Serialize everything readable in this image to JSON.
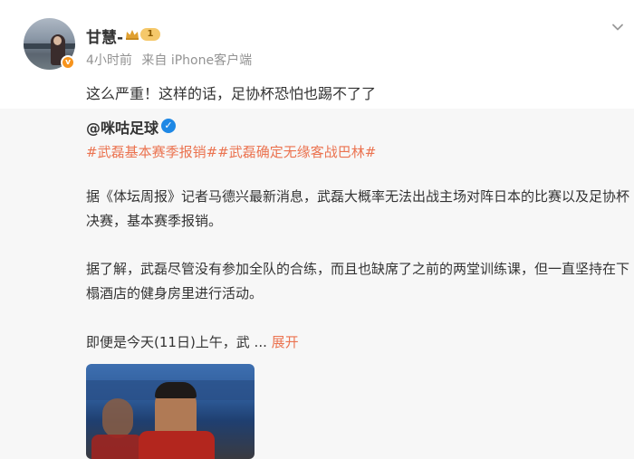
{
  "post": {
    "author_name": "甘慧-",
    "level": "1",
    "time": "4小时前",
    "source": "来自 iPhone客户端",
    "text": "这么严重！这样的话，足协杯恐怕也踢不了了"
  },
  "repost": {
    "author": "@咪咕足球",
    "tags": "#武磊基本赛季报销##武磊确定无缘客战巴林#",
    "paragraph1": "据《体坛周报》记者马德兴最新消息，武磊大概率无法出战主场对阵日本的比赛以及足协杯决赛，基本赛季报销。",
    "paragraph2": "据了解，武磊尽管没有参加全队的合练，而且也缺席了之前的两堂训练课，但一直坚持在下榻酒店的健身房里进行活动。",
    "paragraph3": "即便是今天(11日)上午，武 ...",
    "expand_label": "展开"
  },
  "colors": {
    "accent_orange": "#eb7350",
    "verified_blue": "#1e88e5",
    "repost_bg": "#f7f7f7"
  },
  "icons": [
    "avatar",
    "orange-verified-icon",
    "level-crown-icon",
    "chevron-down-icon",
    "blue-verified-icon",
    "photo-thumbnail"
  ]
}
